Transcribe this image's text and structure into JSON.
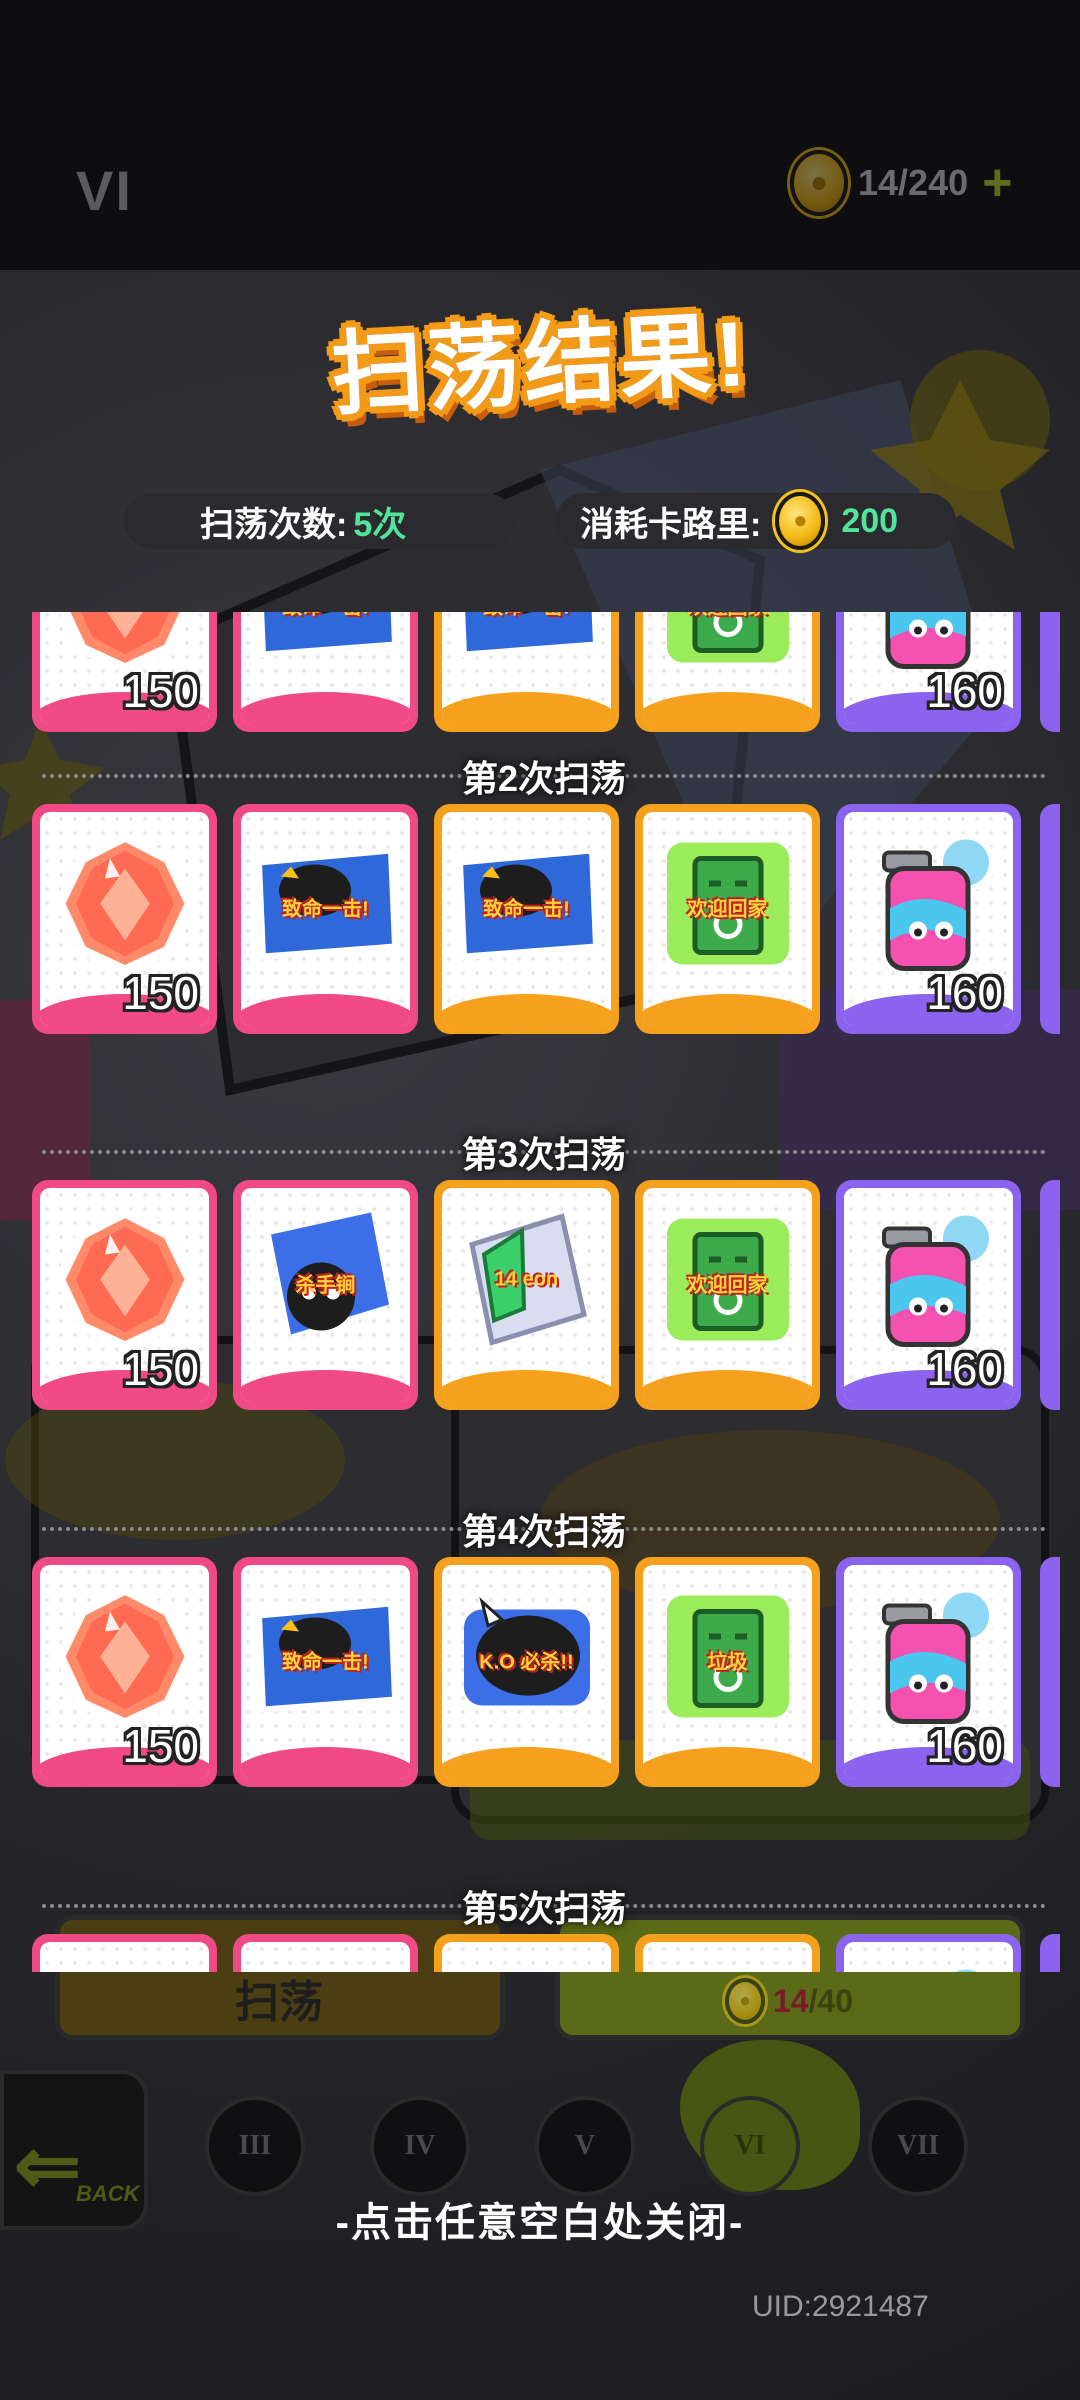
{
  "background": {
    "logo_text": "VI",
    "energy_counter": "14/240",
    "add_symbol": "+",
    "sweep_button_label": "扫荡",
    "sweep_cost_used": "14",
    "sweep_cost_total": "/40",
    "back_label": "BACK",
    "level_tabs": [
      "III",
      "IV",
      "V",
      "VI",
      "VII"
    ],
    "active_level": "VI"
  },
  "dialog": {
    "title": "扫荡结果!",
    "sweep_count_label": "扫荡次数:",
    "sweep_count_value": "5次",
    "cost_label": "消耗卡路里:",
    "cost_value": "200",
    "close_hint": "-点击任意空白处关闭-",
    "uid": "UID:2921487"
  },
  "rounds": [
    {
      "label": "",
      "items": [
        {
          "name": "gem",
          "rarity": "pink",
          "qty": "150"
        },
        {
          "name": "sticker-hit",
          "rarity": "pink",
          "qty": ""
        },
        {
          "name": "sticker-hit",
          "rarity": "orange",
          "qty": ""
        },
        {
          "name": "sticker-box",
          "rarity": "orange",
          "qty": ""
        },
        {
          "name": "spray-can",
          "rarity": "purple",
          "qty": "160"
        }
      ]
    },
    {
      "label": "第2次扫荡",
      "items": [
        {
          "name": "gem",
          "rarity": "pink",
          "qty": "150"
        },
        {
          "name": "sticker-hit",
          "rarity": "pink",
          "qty": ""
        },
        {
          "name": "sticker-hit",
          "rarity": "orange",
          "qty": ""
        },
        {
          "name": "sticker-box",
          "rarity": "orange",
          "qty": ""
        },
        {
          "name": "spray-can",
          "rarity": "purple",
          "qty": "160"
        }
      ]
    },
    {
      "label": "第3次扫荡",
      "items": [
        {
          "name": "gem",
          "rarity": "pink",
          "qty": "150"
        },
        {
          "name": "sticker-killer",
          "rarity": "pink",
          "qty": ""
        },
        {
          "name": "sticker-green-card",
          "rarity": "orange",
          "qty": ""
        },
        {
          "name": "sticker-box",
          "rarity": "orange",
          "qty": ""
        },
        {
          "name": "spray-can",
          "rarity": "purple",
          "qty": "160"
        }
      ]
    },
    {
      "label": "第4次扫荡",
      "items": [
        {
          "name": "gem",
          "rarity": "pink",
          "qty": "150"
        },
        {
          "name": "sticker-hit",
          "rarity": "pink",
          "qty": ""
        },
        {
          "name": "sticker-ko",
          "rarity": "orange",
          "qty": ""
        },
        {
          "name": "sticker-trash",
          "rarity": "orange",
          "qty": ""
        },
        {
          "name": "spray-can",
          "rarity": "purple",
          "qty": "160"
        }
      ]
    },
    {
      "label": "第5次扫荡",
      "items": [
        {
          "name": "gem",
          "rarity": "pink",
          "qty": ""
        },
        {
          "name": "sticker-hit",
          "rarity": "pink",
          "qty": ""
        },
        {
          "name": "sticker-hit",
          "rarity": "orange",
          "qty": ""
        },
        {
          "name": "sticker-box",
          "rarity": "orange",
          "qty": ""
        },
        {
          "name": "spray-can",
          "rarity": "purple",
          "qty": ""
        }
      ]
    }
  ],
  "sticker_text": {
    "hit": "致命一击!",
    "box": "欢迎回家",
    "killer": "杀手锏",
    "ko": "K.O 必杀!!",
    "trash": "垃圾",
    "card": "14 eon"
  },
  "colors": {
    "pink_frame": "#f04a86",
    "orange_frame": "#f6a11e",
    "purple_frame": "#8c63ee",
    "value_green": "#52e49b",
    "title_orange": "#f39a16",
    "coin_gold": "#f4c21a"
  }
}
